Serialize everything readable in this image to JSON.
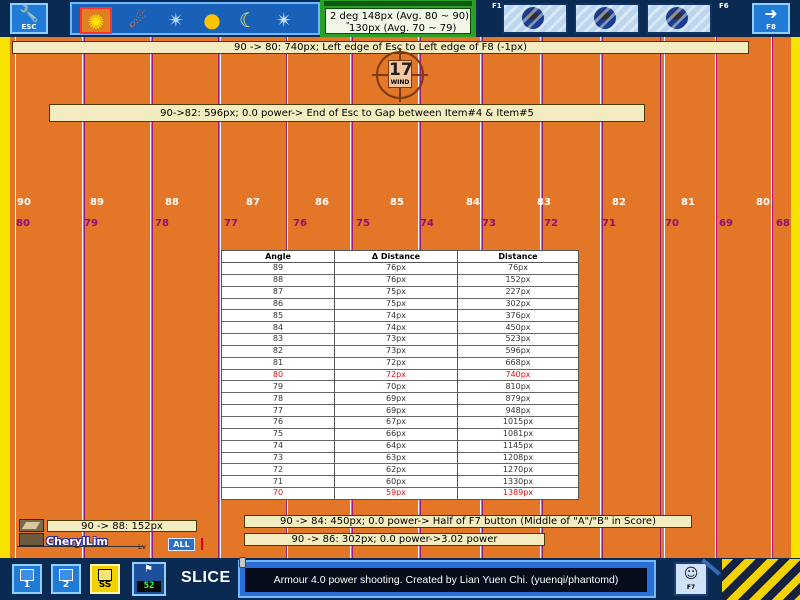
{
  "top_bar": {
    "esc_label": "ESC",
    "f8_label": "F8",
    "f1_label": "F1",
    "f6_label": "F6",
    "items": [
      {
        "icon": "sun-icon",
        "glyph": "✺"
      },
      {
        "icon": "comet-icon",
        "glyph": "☄"
      },
      {
        "icon": "tornado-icon",
        "glyph": "✴"
      },
      {
        "icon": "sun-small-icon",
        "glyph": "●"
      },
      {
        "icon": "moon-icon",
        "glyph": "☾"
      },
      {
        "icon": "tornado-icon",
        "glyph": "✴"
      }
    ],
    "angle_line1": "2 deg   148px (Avg. 80 ~ 90)",
    "angle_quote": "\"",
    "angle_line2": "130px (Avg. 70 ~ 79)"
  },
  "notes": {
    "note_80": "90 -> 80: 740px; Left edge of Esc to Left edge of F8 (-1px)",
    "note_82": "90->82: 596px; 0.0 power-> End of Esc to Gap between Item#4 & Item#5",
    "note_88": "90 -> 88: 152px",
    "note_84": "90 -> 84: 450px; 0.0 power-> Half of F7 button  (Middle of \"A\"/\"B\" in Score)",
    "note_86": "90 -> 86: 302px; 0.0 power->3.02 power"
  },
  "wind": {
    "value": "17",
    "label": "WIND"
  },
  "angle_labels": [
    "90",
    "89",
    "88",
    "87",
    "86",
    "85",
    "84",
    "83",
    "82",
    "81",
    "80"
  ],
  "mark_labels": [
    "80",
    "79",
    "78",
    "77",
    "76",
    "75",
    "74",
    "73",
    "72",
    "71",
    "70",
    "69",
    "68"
  ],
  "table": {
    "headers": [
      "Angle",
      "Δ Distance",
      "Distance"
    ],
    "rows": [
      {
        "angle": "89",
        "delta": "76px",
        "distance": "76px",
        "highlight": false
      },
      {
        "angle": "88",
        "delta": "76px",
        "distance": "152px",
        "highlight": false
      },
      {
        "angle": "87",
        "delta": "75px",
        "distance": "227px",
        "highlight": false
      },
      {
        "angle": "86",
        "delta": "75px",
        "distance": "302px",
        "highlight": false
      },
      {
        "angle": "85",
        "delta": "74px",
        "distance": "376px",
        "highlight": false
      },
      {
        "angle": "84",
        "delta": "74px",
        "distance": "450px",
        "highlight": false
      },
      {
        "angle": "83",
        "delta": "73px",
        "distance": "523px",
        "highlight": false
      },
      {
        "angle": "82",
        "delta": "73px",
        "distance": "596px",
        "highlight": false
      },
      {
        "angle": "81",
        "delta": "72px",
        "distance": "668px",
        "highlight": false
      },
      {
        "angle": "80",
        "delta": "72px",
        "distance": "740px",
        "highlight": true
      },
      {
        "angle": "79",
        "delta": "70px",
        "distance": "810px",
        "highlight": false
      },
      {
        "angle": "78",
        "delta": "69px",
        "distance": "879px",
        "highlight": false
      },
      {
        "angle": "77",
        "delta": "69px",
        "distance": "948px",
        "highlight": false
      },
      {
        "angle": "76",
        "delta": "67px",
        "distance": "1015px",
        "highlight": false
      },
      {
        "angle": "75",
        "delta": "66px",
        "distance": "1081px",
        "highlight": false
      },
      {
        "angle": "74",
        "delta": "64px",
        "distance": "1145px",
        "highlight": false
      },
      {
        "angle": "73",
        "delta": "63px",
        "distance": "1208px",
        "highlight": false
      },
      {
        "angle": "72",
        "delta": "62px",
        "distance": "1270px",
        "highlight": false
      },
      {
        "angle": "71",
        "delta": "60px",
        "distance": "1330px",
        "highlight": false
      },
      {
        "angle": "70",
        "delta": "59px",
        "distance": "1389px",
        "highlight": true
      }
    ]
  },
  "player": {
    "name": "CherylLim",
    "badge": "Lv",
    "chat_scope": "ALL"
  },
  "bottom_bar": {
    "modes": [
      "1",
      "2",
      "SS"
    ],
    "move_value": "52",
    "weapon": "SLICE",
    "power_text": "Armour 4.0 power shooting. Created by Lian Yuen Chi. (yuenqi/phantomd)",
    "f7_label": "F7"
  },
  "colors": {
    "field": "#e37627",
    "frame": "#f7e200",
    "hud": "#0b2a52",
    "angle_line": "#ffffff",
    "mark_line": "#9c1a7a",
    "highlight": "#e01010"
  }
}
